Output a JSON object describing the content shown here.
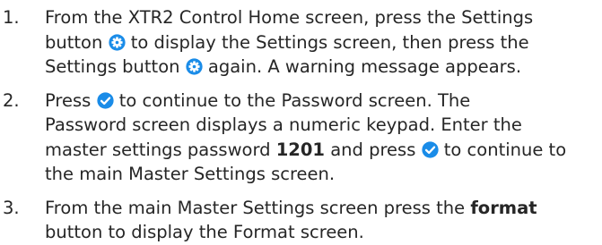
{
  "steps": [
    {
      "number": "1.",
      "line1": "From the XTR2 Control Home screen, press the Settings",
      "line2a": "button",
      "line2b": "to display the Settings screen, then press the",
      "line3a": "Settings button",
      "line3b": "again. A warning message appears."
    },
    {
      "number": "2.",
      "line1a": "Press",
      "line1b": "to continue to the Password screen. The",
      "line2": "Password screen displays a numeric keypad. Enter the",
      "line3a": "master settings password",
      "line3bold": "1201",
      "line3b": "and press",
      "line3c": "to continue to",
      "line4": "the main Master Settings screen."
    },
    {
      "number": "3.",
      "line1a": "From the main Master Settings screen press the",
      "line1bold": "format",
      "line2": "button to display the Format screen."
    }
  ],
  "icons": {
    "settings": "gear-icon",
    "confirm": "checkmark-icon",
    "accent_color": "#1a8ce8"
  }
}
